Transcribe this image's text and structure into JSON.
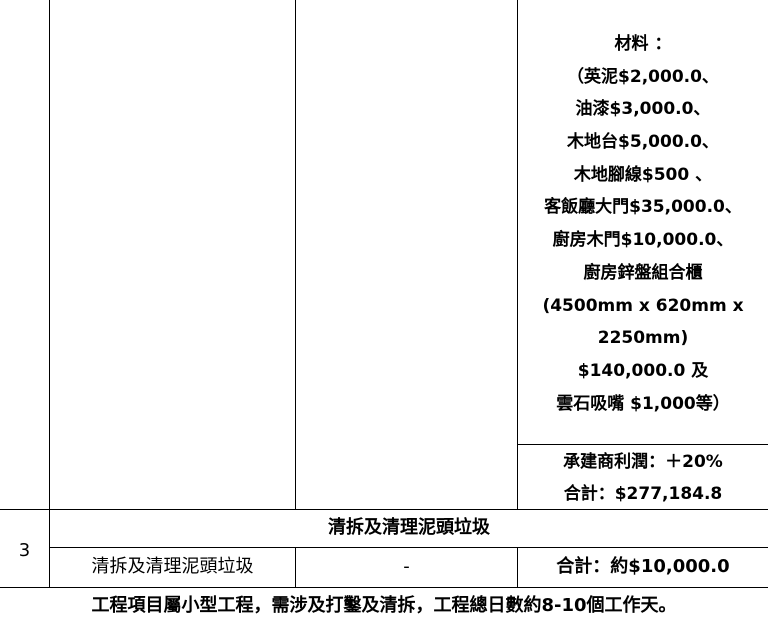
{
  "materials": {
    "lines": [
      "材料 ：",
      "（英泥$2,000.0、",
      "油漆$3,000.0、",
      "木地台$5,000.0、",
      "木地腳線$500 、",
      "客飯廳大門$35,000.0、",
      "廚房木門$10,000.0、",
      "廚房鋅盤組合櫃",
      "(4500mm x 620mm x",
      "2250mm)",
      "$140,000.0 及",
      "雲石吸嘴 $1,000等）"
    ]
  },
  "profit_label": "承建商利潤：＋20%",
  "total_1": "合計：$277,184.8",
  "row": {
    "number": "3",
    "section_title": "清拆及清理泥頭垃圾",
    "description": "清拆及清理泥頭垃圾",
    "quantity": "-",
    "total": "合計：約$10,000.0"
  },
  "footer_note": "工程項目屬小型工程，需涉及打鑿及清拆，工程總日數約8-10個工作天。"
}
